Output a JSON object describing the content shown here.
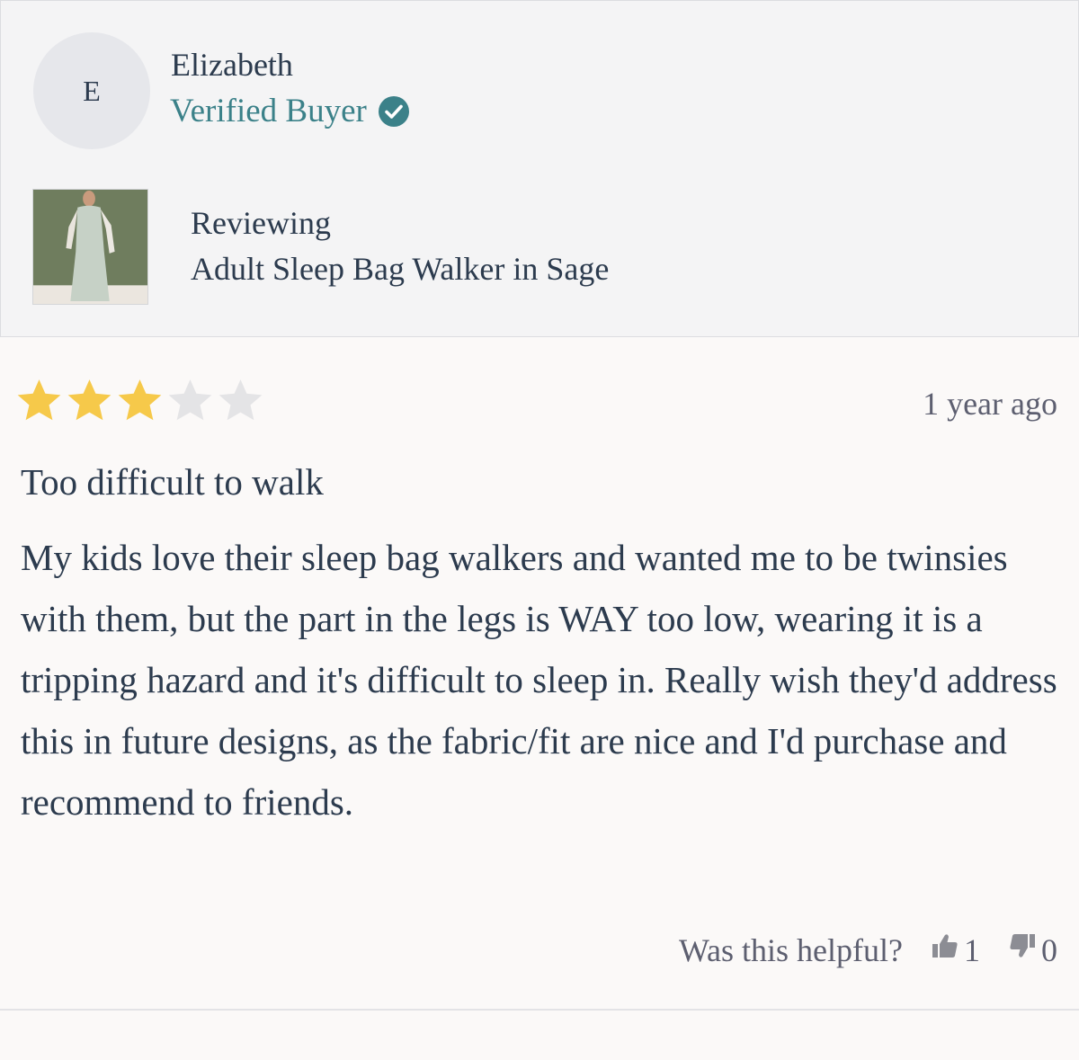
{
  "reviewer": {
    "initial": "E",
    "name": "Elizabeth",
    "badge": "Verified Buyer"
  },
  "product": {
    "reviewing_label": "Reviewing",
    "name": "Adult Sleep Bag Walker in Sage"
  },
  "review": {
    "rating": 3,
    "max_rating": 5,
    "timestamp": "1 year ago",
    "title": "Too difficult to walk",
    "body": "My kids love their sleep bag walkers and wanted me to be twinsies with them, but the part in the legs is WAY too low, wearing it is a tripping hazard and it's difficult to sleep in. Really wish they'd address this in future designs, as the fabric/fit are nice and I'd purchase and recommend to friends."
  },
  "helpful": {
    "question": "Was this helpful?",
    "upvotes": "1",
    "downvotes": "0"
  },
  "colors": {
    "accent": "#3b8189",
    "star_filled": "#f6c94a",
    "star_empty": "#e4e4e6",
    "text": "#2c3b4e"
  },
  "icons": {
    "verified": "check-circle-icon",
    "upvote": "thumbs-up-icon",
    "downvote": "thumbs-down-icon"
  }
}
